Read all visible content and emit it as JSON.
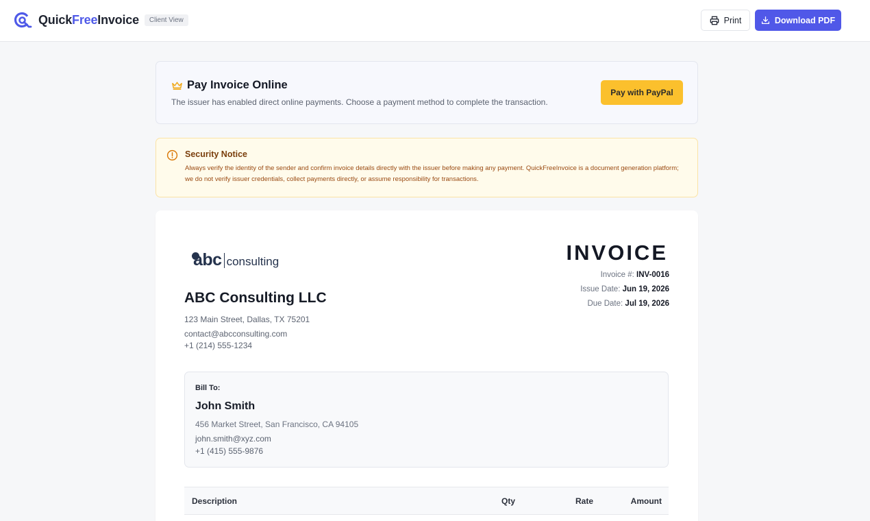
{
  "header": {
    "brand_prefix": "Quick",
    "brand_accent": "Free",
    "brand_suffix": "Invoice",
    "badge": "Client View",
    "print_label": "Print",
    "download_label": "Download PDF"
  },
  "pay": {
    "title": "Pay Invoice Online",
    "description": "The issuer has enabled direct online payments. Choose a payment method to complete the transaction.",
    "paypal_label": "Pay with PayPal"
  },
  "notice": {
    "title": "Security Notice",
    "body": "Always verify the identity of the sender and confirm invoice details directly with the issuer before making any payment. QuickFreeInvoice is a document generation platform; we do not verify issuer credentials, collect payments directly, or assume responsibility for transactions."
  },
  "company": {
    "logo_main": "abc",
    "logo_sub": "consulting",
    "name": "ABC Consulting LLC",
    "address": "123 Main Street, Dallas, TX 75201",
    "email": "contact@abcconsulting.com",
    "phone": "+1 (214) 555-1234"
  },
  "invoice": {
    "title": "INVOICE",
    "number_label": "Invoice #:",
    "number": "INV-0016",
    "issue_label": "Issue Date:",
    "issue_date": "Jun 19, 2026",
    "due_label": "Due Date:",
    "due_date": "Jul 19, 2026"
  },
  "bill_to": {
    "label": "Bill To:",
    "name": "John Smith",
    "address": "456 Market Street, San Francisco, CA 94105",
    "email": "john.smith@xyz.com",
    "phone": "+1 (415) 555-9876"
  },
  "table": {
    "headers": [
      "Description",
      "Qty",
      "Rate",
      "Amount"
    ]
  },
  "colors": {
    "accent": "#5058e8",
    "paypal": "#fbc02d",
    "notice_bg": "#fffbeb"
  }
}
